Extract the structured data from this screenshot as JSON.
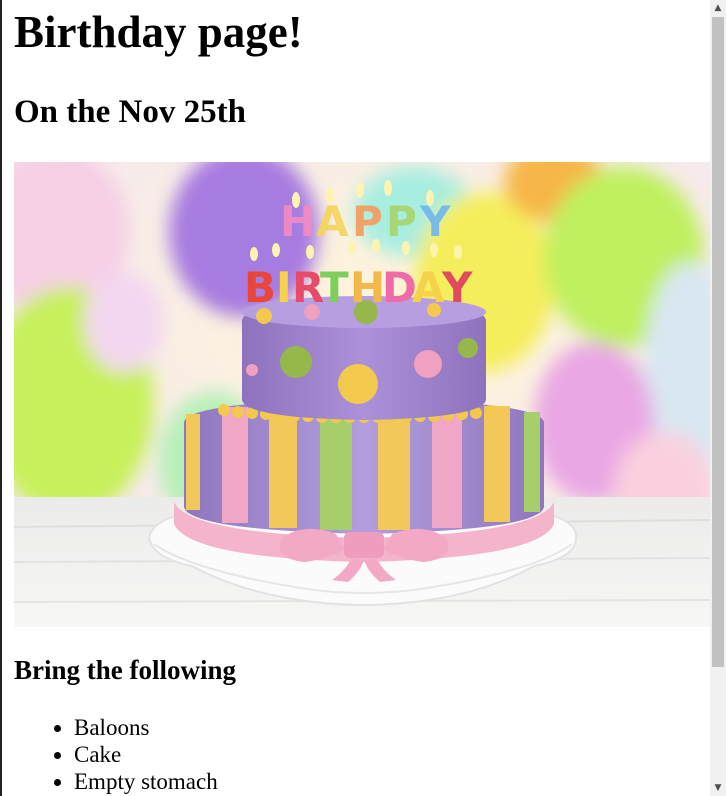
{
  "page": {
    "title": "Birthday page!",
    "subtitle": "On the Nov 25th",
    "image": {
      "cake_topper_line1": "HAPPY",
      "cake_topper_line2": "BIRTHDAY"
    },
    "list_heading": "Bring the following",
    "items": [
      {
        "label": "Baloons"
      },
      {
        "label": "Cake"
      },
      {
        "label": "Empty stomach"
      }
    ]
  },
  "scrollbar": {
    "up_arrow_icon": "triangle-up-icon",
    "down_arrow_icon": "triangle-down-icon"
  },
  "colors": {
    "cake_top": "#9f7fc7",
    "cake_bottom": "#a58bd2",
    "ribbon_pink": "#f4b4cc",
    "stripe_yellow": "#f2c85a",
    "stripe_green": "#a6cf6c",
    "stripe_pink": "#f0a6c4",
    "dot_yellow": "#f2c94c",
    "dot_green": "#96b84a",
    "dot_pink": "#f0a0c0"
  }
}
